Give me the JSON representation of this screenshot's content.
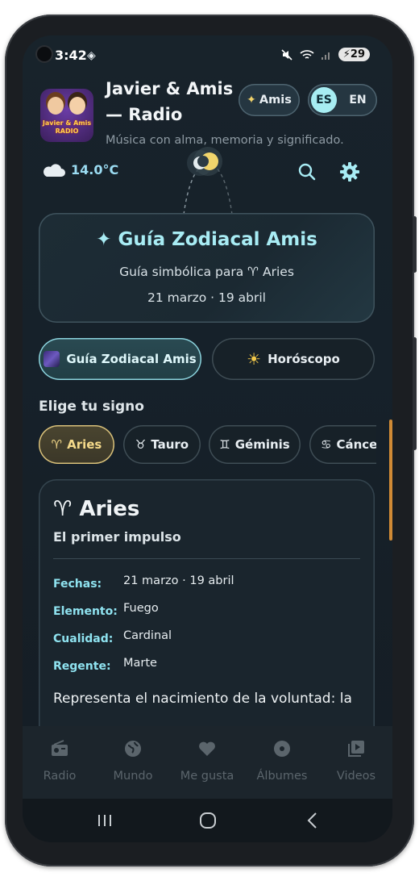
{
  "status": {
    "time": "3:42",
    "battery": "29"
  },
  "header": {
    "app_title": "Javier & Amis — Radio",
    "tagline": "Música con alma, memoria y significado.",
    "logo_text_1": "Javier & Amis",
    "logo_text_2": "RADIO",
    "amis_button": "Amis",
    "lang_es": "ES",
    "lang_en": "EN"
  },
  "weather": {
    "temperature": "14.0°C",
    "icon": "cloud-icon"
  },
  "guide_card": {
    "title": "Guía Zodiacal Amis",
    "subtitle": "Guía simbólica para ♈ Aries",
    "dates": "21 marzo · 19 abril"
  },
  "tabs": [
    {
      "label": "Guía Zodiacal Amis",
      "active": true
    },
    {
      "label": "Horóscopo",
      "active": false
    }
  ],
  "sign_section": {
    "label": "Elige tu signo",
    "chips": [
      {
        "symbol": "♈",
        "name": "Aries",
        "active": true
      },
      {
        "symbol": "♉",
        "name": "Tauro",
        "active": false
      },
      {
        "symbol": "♊",
        "name": "Géminis",
        "active": false
      },
      {
        "symbol": "♋",
        "name": "Cáncer",
        "active": false
      }
    ]
  },
  "detail": {
    "title": "♈ Aries",
    "subtitle": "El primer impulso",
    "rows": [
      {
        "label": "Fechas:",
        "value": "21 marzo · 19 abril"
      },
      {
        "label": "Elemento:",
        "value": "Fuego"
      },
      {
        "label": "Cualidad:",
        "value": "Cardinal"
      },
      {
        "label": "Regente:",
        "value": "Marte"
      }
    ],
    "description": "Representa el nacimiento de la voluntad: la"
  },
  "bottom_nav": [
    {
      "label": "Radio",
      "icon": "radio-icon"
    },
    {
      "label": "Mundo",
      "icon": "globe-icon"
    },
    {
      "label": "Me gusta",
      "icon": "heart-icon"
    },
    {
      "label": "Álbumes",
      "icon": "disc-icon"
    },
    {
      "label": "Videos",
      "icon": "video-library-icon"
    }
  ],
  "colors": {
    "accent_cyan": "#a8ecf4",
    "accent_gold": "#f4d98a",
    "background": "#172027",
    "scroll_indicator": "#d08a35"
  }
}
